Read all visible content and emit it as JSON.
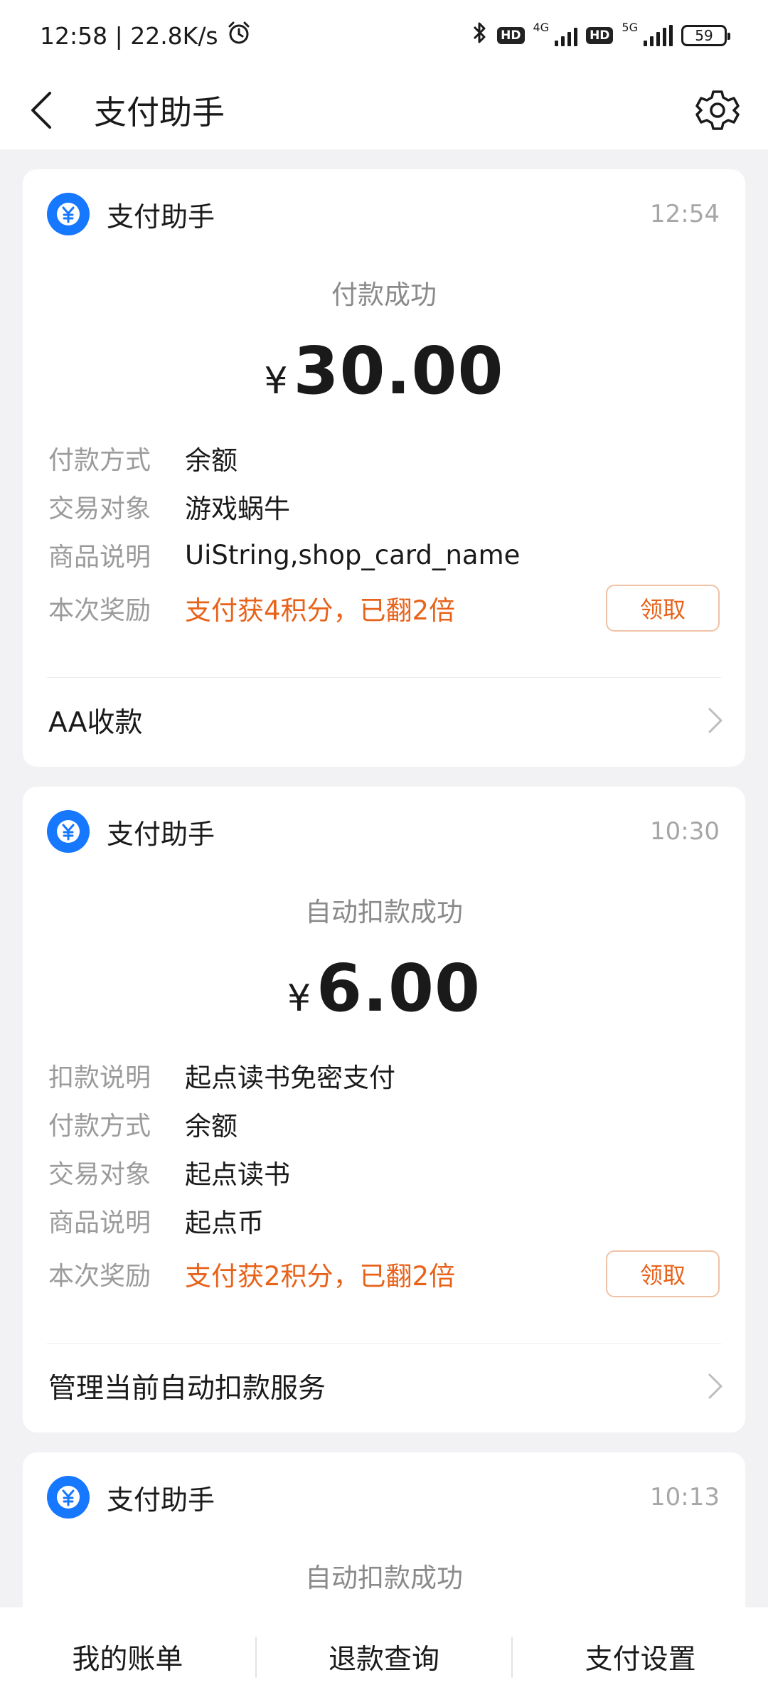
{
  "status_bar": {
    "time_speed": "12:58 | 22.8K/s",
    "hd_label": "HD",
    "net_4g": "4G",
    "net_5g": "5G",
    "battery": "59"
  },
  "header": {
    "title": "支付助手"
  },
  "cards": [
    {
      "brand": "支付助手",
      "time": "12:54",
      "status": "付款成功",
      "currency": "¥",
      "amount": "30.00",
      "rows": [
        {
          "label": "付款方式",
          "value": "余额"
        },
        {
          "label": "交易对象",
          "value": "游戏蜗牛"
        },
        {
          "label": "商品说明",
          "value": "UiString,shop_card_name"
        }
      ],
      "reward": {
        "label": "本次奖励",
        "value": "支付获4积分，已翻2倍",
        "button": "领取"
      },
      "link": "AA收款"
    },
    {
      "brand": "支付助手",
      "time": "10:30",
      "status": "自动扣款成功",
      "currency": "¥",
      "amount": "6.00",
      "rows": [
        {
          "label": "扣款说明",
          "value": "起点读书免密支付"
        },
        {
          "label": "付款方式",
          "value": "余额"
        },
        {
          "label": "交易对象",
          "value": "起点读书"
        },
        {
          "label": "商品说明",
          "value": "起点币"
        }
      ],
      "reward": {
        "label": "本次奖励",
        "value": "支付获2积分，已翻2倍",
        "button": "领取"
      },
      "link": "管理当前自动扣款服务"
    },
    {
      "brand": "支付助手",
      "time": "10:13",
      "status": "自动扣款成功"
    }
  ],
  "bottom_bar": {
    "items": [
      "我的账单",
      "退款查询",
      "支付设置"
    ]
  },
  "colors": {
    "brand_blue": "#1677ff",
    "reward_orange": "#e8621a",
    "background": "#f2f2f4"
  }
}
